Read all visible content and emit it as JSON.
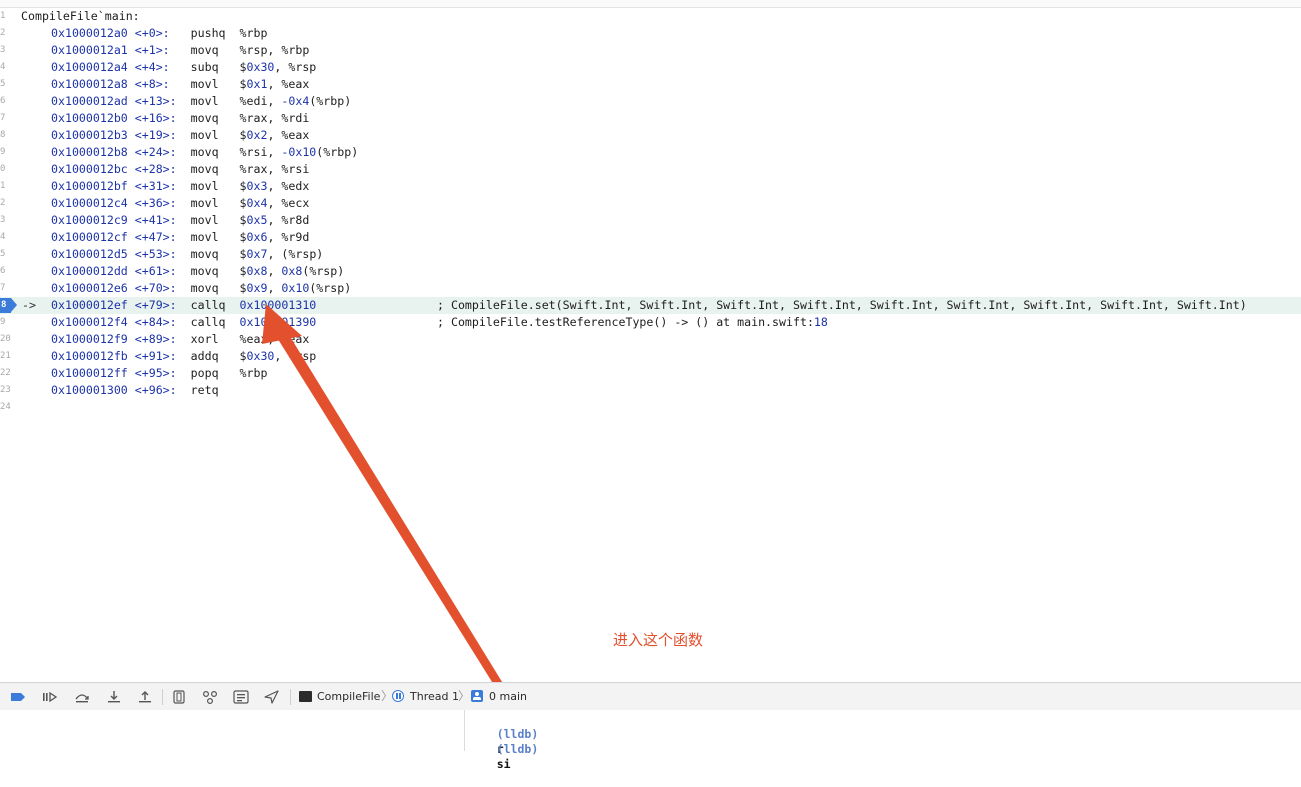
{
  "disassembly": {
    "function_label": "CompileFile`main:",
    "current_line_number": "8",
    "current_marker": "->",
    "instructions": [
      {
        "line": "2",
        "addr": "0x1000012a0",
        "off": "<+0>:",
        "op": "pushq",
        "args": "%rbp",
        "comment": ""
      },
      {
        "line": "3",
        "addr": "0x1000012a1",
        "off": "<+1>:",
        "op": "movq",
        "args": "%rsp, %rbp",
        "comment": ""
      },
      {
        "line": "4",
        "addr": "0x1000012a4",
        "off": "<+4>:",
        "op": "subq",
        "args": "$0x30, %rsp",
        "comment": ""
      },
      {
        "line": "5",
        "addr": "0x1000012a8",
        "off": "<+8>:",
        "op": "movl",
        "args": "$0x1, %eax",
        "comment": ""
      },
      {
        "line": "6",
        "addr": "0x1000012ad",
        "off": "<+13>:",
        "op": "movl",
        "args": "%edi, -0x4(%rbp)",
        "comment": ""
      },
      {
        "line": "7",
        "addr": "0x1000012b0",
        "off": "<+16>:",
        "op": "movq",
        "args": "%rax, %rdi",
        "comment": ""
      },
      {
        "line": "8",
        "addr": "0x1000012b3",
        "off": "<+19>:",
        "op": "movl",
        "args": "$0x2, %eax",
        "comment": ""
      },
      {
        "line": "9",
        "addr": "0x1000012b8",
        "off": "<+24>:",
        "op": "movq",
        "args": "%rsi, -0x10(%rbp)",
        "comment": ""
      },
      {
        "line": "0",
        "addr": "0x1000012bc",
        "off": "<+28>:",
        "op": "movq",
        "args": "%rax, %rsi",
        "comment": ""
      },
      {
        "line": "1",
        "addr": "0x1000012bf",
        "off": "<+31>:",
        "op": "movl",
        "args": "$0x3, %edx",
        "comment": ""
      },
      {
        "line": "2",
        "addr": "0x1000012c4",
        "off": "<+36>:",
        "op": "movl",
        "args": "$0x4, %ecx",
        "comment": ""
      },
      {
        "line": "3",
        "addr": "0x1000012c9",
        "off": "<+41>:",
        "op": "movl",
        "args": "$0x5, %r8d",
        "comment": ""
      },
      {
        "line": "4",
        "addr": "0x1000012cf",
        "off": "<+47>:",
        "op": "movl",
        "args": "$0x6, %r9d",
        "comment": ""
      },
      {
        "line": "5",
        "addr": "0x1000012d5",
        "off": "<+53>:",
        "op": "movq",
        "args": "$0x7, (%rsp)",
        "comment": ""
      },
      {
        "line": "6",
        "addr": "0x1000012dd",
        "off": "<+61>:",
        "op": "movq",
        "args": "$0x8, 0x8(%rsp)",
        "comment": ""
      },
      {
        "line": "7",
        "addr": "0x1000012e6",
        "off": "<+70>:",
        "op": "movq",
        "args": "$0x9, 0x10(%rsp)",
        "comment": ""
      },
      {
        "line": "8",
        "addr": "0x1000012ef",
        "off": "<+79>:",
        "op": "callq",
        "args": "0x100001310",
        "comment": "; CompileFile.set(Swift.Int, Swift.Int, Swift.Int, Swift.Int, Swift.Int, Swift.Int, Swift.Int, Swift.Int, Swift.Int)"
      },
      {
        "line": "9",
        "addr": "0x1000012f4",
        "off": "<+84>:",
        "op": "callq",
        "args": "0x100001390",
        "comment": "; CompileFile.testReferenceType() -> () at main.swift:18"
      },
      {
        "line": "20",
        "addr": "0x1000012f9",
        "off": "<+89>:",
        "op": "xorl",
        "args": "%eax, %eax",
        "comment": ""
      },
      {
        "line": "21",
        "addr": "0x1000012fb",
        "off": "<+91>:",
        "op": "addq",
        "args": "$0x30, %rsp",
        "comment": ""
      },
      {
        "line": "22",
        "addr": "0x1000012ff",
        "off": "<+95>:",
        "op": "popq",
        "args": "%rbp",
        "comment": ""
      },
      {
        "line": "23",
        "addr": "0x100001300",
        "off": "<+96>:",
        "op": "retq",
        "args": "",
        "comment": ""
      }
    ],
    "first_line_number": "1",
    "last_line_number": "24"
  },
  "annotation": {
    "text": "进入这个函数",
    "color": "#e2502e"
  },
  "debug_bar": {
    "buttons": [
      {
        "name": "breakpoints-toggle-button",
        "icon": "breakpoint-icon"
      },
      {
        "name": "continue-button",
        "icon": "continue-icon"
      },
      {
        "name": "step-over-button",
        "icon": "step-over-icon"
      },
      {
        "name": "step-into-button",
        "icon": "step-into-icon"
      },
      {
        "name": "step-out-button",
        "icon": "step-out-icon"
      },
      {
        "name": "debug-view-hierarchy-button",
        "icon": "view-hierarchy-icon"
      },
      {
        "name": "memory-graph-button",
        "icon": "memory-graph-icon"
      },
      {
        "name": "environment-overrides-button",
        "icon": "environment-overrides-icon"
      },
      {
        "name": "simulate-location-button",
        "icon": "location-icon"
      }
    ],
    "breadcrumb": {
      "target": "CompileFile",
      "thread": "Thread 1",
      "frame": "0 main"
    }
  },
  "console": {
    "lines": [
      {
        "prompt": "(lldb)",
        "command": "r"
      },
      {
        "prompt": "(lldb)",
        "command": "si"
      }
    ]
  },
  "colors": {
    "pc_marker": "#3b7bd9",
    "current_line_bg": "#e8f2ef",
    "address": "#1c33a8"
  }
}
